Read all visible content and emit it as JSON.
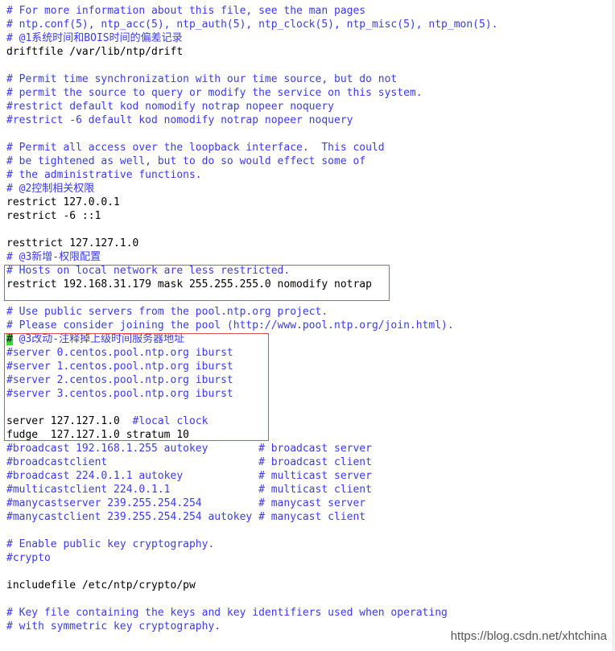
{
  "editor": {
    "lines": [
      "# For more information about this file, see the man pages",
      "# ntp.conf(5), ntp_acc(5), ntp_auth(5), ntp_clock(5), ntp_misc(5), ntp_mon(5).",
      "# @1系统时间和BOIS时间的偏差记录",
      "driftfile /var/lib/ntp/drift",
      "",
      "# Permit time synchronization with our time source, but do not",
      "# permit the source to query or modify the service on this system.",
      "#restrict default kod nomodify notrap nopeer noquery",
      "#restrict -6 default kod nomodify notrap nopeer noquery",
      "",
      "# Permit all access over the loopback interface.  This could",
      "# be tightened as well, but to do so would effect some of",
      "# the administrative functions.",
      "# @2控制相关权限",
      "restrict 127.0.0.1",
      "restrict -6 ::1",
      "",
      "resttrict 127.127.1.0",
      "# @3新增-权限配置",
      "# Hosts on local network are less restricted.",
      "restrict 192.168.31.179 mask 255.255.255.0 nomodify notrap",
      "",
      "# Use public servers from the pool.ntp.org project.",
      "# Please consider joining the pool (http://www.pool.ntp.org/join.html).",
      " @3改动-注释掉上级时间服务器地址",
      "#server 0.centos.pool.ntp.org iburst",
      "#server 1.centos.pool.ntp.org iburst",
      "#server 2.centos.pool.ntp.org iburst",
      "#server 3.centos.pool.ntp.org iburst",
      "",
      "server 127.127.1.0  ",
      "fudge  127.127.1.0 stratum 10",
      "#broadcast 192.168.1.255 autokey        # broadcast server",
      "#broadcastclient                        # broadcast client",
      "#broadcast 224.0.1.1 autokey            # multicast server",
      "#multicastclient 224.0.1.1              # multicast client",
      "#manycastserver 239.255.254.254         # manycast server",
      "#manycastclient 239.255.254.254 autokey # manycast client",
      "",
      "# Enable public key cryptography.",
      "#crypto",
      "",
      "includefile /etc/ntp/crypto/pw",
      "",
      "# Key file containing the keys and key identifiers used when operating",
      "# with symmetric key cryptography."
    ],
    "cursor_char": "#",
    "server_comment": "#local clock"
  },
  "colors": {
    "comment": "#3a3af7",
    "text": "#000000",
    "cursor_bg": "#33dd33",
    "highlight_border": "#e05050"
  },
  "watermark": "https://blog.csdn.net/xhtchina"
}
